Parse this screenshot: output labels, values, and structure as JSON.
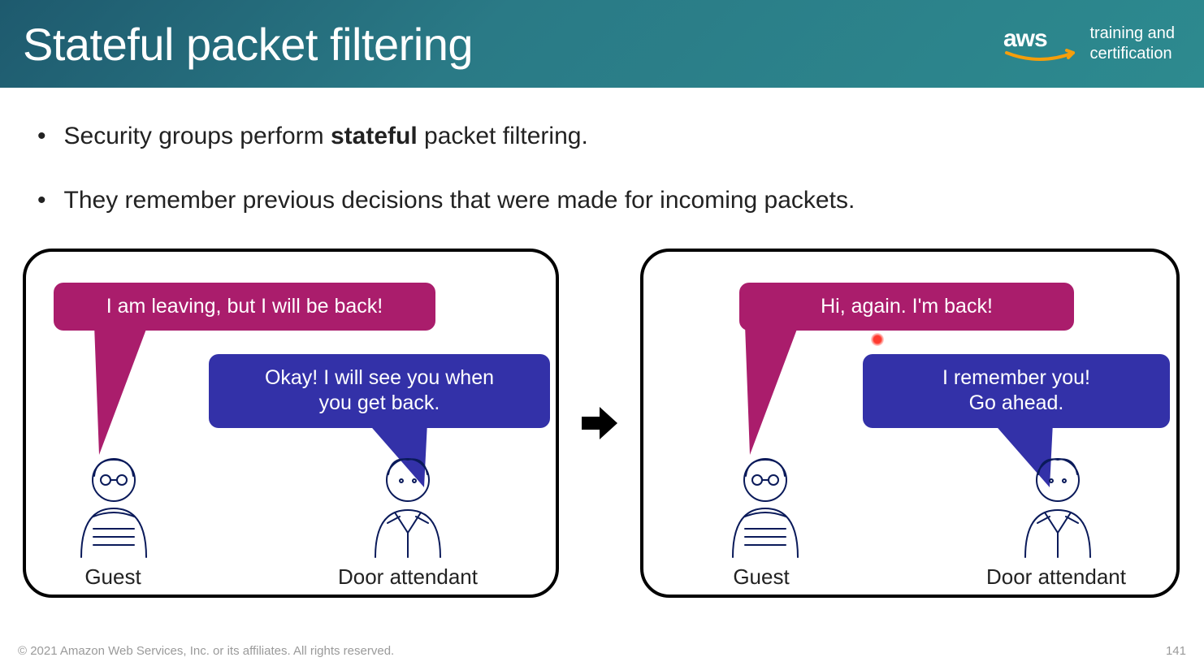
{
  "header": {
    "title": "Stateful packet filtering",
    "logo_text": "aws",
    "logo_caption_line1": "training and",
    "logo_caption_line2": "certification"
  },
  "bullets": [
    {
      "pre": "Security groups perform ",
      "bold": "stateful",
      "post": " packet filtering."
    },
    {
      "text": "They remember previous decisions that were made for incoming packets."
    }
  ],
  "panels": {
    "left": {
      "guest_bubble": "I am leaving, but I will be back!",
      "attendant_bubble_line1": "Okay! I will see you when",
      "attendant_bubble_line2": "you get back.",
      "guest_label": "Guest",
      "attendant_label": "Door attendant"
    },
    "right": {
      "guest_bubble": "Hi, again. I'm back!",
      "attendant_bubble_line1": "I remember you!",
      "attendant_bubble_line2": "Go ahead.",
      "guest_label": "Guest",
      "attendant_label": "Door attendant"
    }
  },
  "footer": {
    "copyright": "© 2021 Amazon Web Services, Inc. or its affiliates. All rights reserved.",
    "page_number": "141"
  },
  "colors": {
    "guest_bubble": "#aa1d6c",
    "attendant_bubble": "#3331a8",
    "header_gradient_from": "#1e5a6e",
    "header_gradient_to": "#2d8a8f"
  }
}
